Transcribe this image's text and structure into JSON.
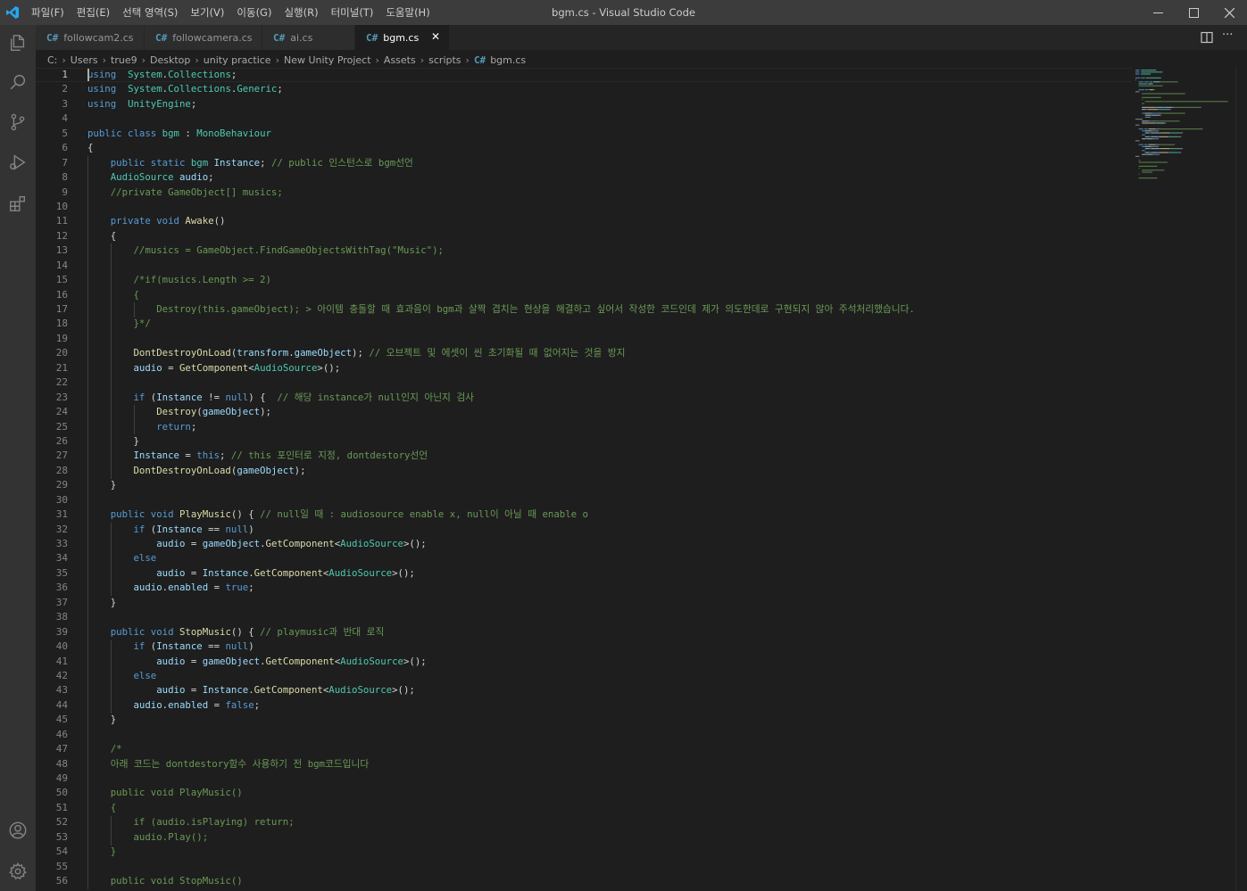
{
  "window": {
    "title": "bgm.cs - Visual Studio Code",
    "menu": [
      "파일(F)",
      "편집(E)",
      "선택 영역(S)",
      "보기(V)",
      "이동(G)",
      "실행(R)",
      "터미널(T)",
      "도움말(H)"
    ]
  },
  "tabs": [
    {
      "label": "followcam2.cs",
      "icon": "csharp-icon",
      "active": false
    },
    {
      "label": "followcamera.cs",
      "icon": "csharp-icon",
      "active": false
    },
    {
      "label": "ai.cs",
      "icon": "csharp-icon",
      "active": false
    },
    {
      "label": "bgm.cs",
      "icon": "csharp-icon",
      "active": true
    }
  ],
  "breadcrumb": [
    "C:",
    "Users",
    "true9",
    "Desktop",
    "unity practice",
    "New Unity Project",
    "Assets",
    "scripts",
    "bgm.cs"
  ],
  "editor": {
    "current_line": 1,
    "lines": [
      {
        "n": 1,
        "tokens": [
          [
            "k",
            "using"
          ],
          [
            "",
            "  "
          ],
          [
            "t",
            "System"
          ],
          [
            "",
            "."
          ],
          [
            "t",
            "Collections"
          ],
          [
            "",
            ";"
          ]
        ]
      },
      {
        "n": 2,
        "tokens": [
          [
            "k",
            "using"
          ],
          [
            "",
            "  "
          ],
          [
            "t",
            "System"
          ],
          [
            "",
            "."
          ],
          [
            "t",
            "Collections"
          ],
          [
            "",
            "."
          ],
          [
            "t",
            "Generic"
          ],
          [
            "",
            ";"
          ]
        ]
      },
      {
        "n": 3,
        "tokens": [
          [
            "k",
            "using"
          ],
          [
            "",
            "  "
          ],
          [
            "t",
            "UnityEngine"
          ],
          [
            "",
            ";"
          ]
        ]
      },
      {
        "n": 4,
        "tokens": []
      },
      {
        "n": 5,
        "tokens": [
          [
            "k",
            "public"
          ],
          [
            "",
            " "
          ],
          [
            "k",
            "class"
          ],
          [
            "",
            " "
          ],
          [
            "t",
            "bgm"
          ],
          [
            "",
            " : "
          ],
          [
            "t",
            "MonoBehaviour"
          ]
        ]
      },
      {
        "n": 6,
        "tokens": [
          [
            "",
            "{"
          ]
        ]
      },
      {
        "n": 7,
        "tokens": [
          [
            "",
            "    "
          ],
          [
            "k",
            "public"
          ],
          [
            "",
            " "
          ],
          [
            "k",
            "static"
          ],
          [
            "",
            " "
          ],
          [
            "t",
            "bgm"
          ],
          [
            "",
            " "
          ],
          [
            "v",
            "Instance"
          ],
          [
            "",
            "; "
          ],
          [
            "c",
            "// public 인스턴스로 bgm선언"
          ]
        ]
      },
      {
        "n": 8,
        "tokens": [
          [
            "",
            "    "
          ],
          [
            "t",
            "AudioSource"
          ],
          [
            "",
            " "
          ],
          [
            "v",
            "audio"
          ],
          [
            "",
            ";"
          ]
        ]
      },
      {
        "n": 9,
        "tokens": [
          [
            "",
            "    "
          ],
          [
            "c",
            "//private GameObject[] musics;"
          ]
        ]
      },
      {
        "n": 10,
        "tokens": []
      },
      {
        "n": 11,
        "tokens": [
          [
            "",
            "    "
          ],
          [
            "k",
            "private"
          ],
          [
            "",
            " "
          ],
          [
            "k",
            "void"
          ],
          [
            "",
            " "
          ],
          [
            "f",
            "Awake"
          ],
          [
            "",
            "()"
          ]
        ]
      },
      {
        "n": 12,
        "tokens": [
          [
            "",
            "    {"
          ]
        ]
      },
      {
        "n": 13,
        "tokens": [
          [
            "",
            "        "
          ],
          [
            "c",
            "//musics = GameObject.FindGameObjectsWithTag(\"Music\");"
          ]
        ]
      },
      {
        "n": 14,
        "tokens": []
      },
      {
        "n": 15,
        "tokens": [
          [
            "",
            "        "
          ],
          [
            "c",
            "/*if(musics.Length >= 2)"
          ]
        ]
      },
      {
        "n": 16,
        "tokens": [
          [
            "",
            "        "
          ],
          [
            "c",
            "{"
          ]
        ]
      },
      {
        "n": 17,
        "tokens": [
          [
            "",
            "            "
          ],
          [
            "c",
            "Destroy(this.gameObject); > 아이템 충돌할 때 효과음이 bgm과 살짝 겹치는 현상을 해결하고 싶어서 작성한 코드인데 제가 의도한데로 구현되지 않아 주석처리했습니다."
          ]
        ]
      },
      {
        "n": 18,
        "tokens": [
          [
            "",
            "        "
          ],
          [
            "c",
            "}*/"
          ]
        ]
      },
      {
        "n": 19,
        "tokens": []
      },
      {
        "n": 20,
        "tokens": [
          [
            "",
            "        "
          ],
          [
            "f",
            "DontDestroyOnLoad"
          ],
          [
            "",
            "("
          ],
          [
            "v",
            "transform"
          ],
          [
            "",
            "."
          ],
          [
            "v",
            "gameObject"
          ],
          [
            "",
            "); "
          ],
          [
            "c",
            "// 오브젝트 및 에셋이 씬 초기화될 때 없어지는 것을 방지"
          ]
        ]
      },
      {
        "n": 21,
        "tokens": [
          [
            "",
            "        "
          ],
          [
            "v",
            "audio"
          ],
          [
            "",
            " = "
          ],
          [
            "f",
            "GetComponent"
          ],
          [
            "",
            "<"
          ],
          [
            "t",
            "AudioSource"
          ],
          [
            "",
            ">();"
          ]
        ]
      },
      {
        "n": 22,
        "tokens": []
      },
      {
        "n": 23,
        "tokens": [
          [
            "",
            "        "
          ],
          [
            "k",
            "if"
          ],
          [
            "",
            " ("
          ],
          [
            "v",
            "Instance"
          ],
          [
            "",
            " != "
          ],
          [
            "k",
            "null"
          ],
          [
            "",
            ") {  "
          ],
          [
            "c",
            "// 해당 instance가 null인지 아닌지 검사"
          ]
        ]
      },
      {
        "n": 24,
        "tokens": [
          [
            "",
            "            "
          ],
          [
            "f",
            "Destroy"
          ],
          [
            "",
            "("
          ],
          [
            "v",
            "gameObject"
          ],
          [
            "",
            ");"
          ]
        ]
      },
      {
        "n": 25,
        "tokens": [
          [
            "",
            "            "
          ],
          [
            "k",
            "return"
          ],
          [
            "",
            ";"
          ]
        ]
      },
      {
        "n": 26,
        "tokens": [
          [
            "",
            "        }"
          ]
        ]
      },
      {
        "n": 27,
        "tokens": [
          [
            "",
            "        "
          ],
          [
            "v",
            "Instance"
          ],
          [
            "",
            " = "
          ],
          [
            "k",
            "this"
          ],
          [
            "",
            "; "
          ],
          [
            "c",
            "// this 포인터로 지정, dontdestory선언"
          ]
        ]
      },
      {
        "n": 28,
        "tokens": [
          [
            "",
            "        "
          ],
          [
            "f",
            "DontDestroyOnLoad"
          ],
          [
            "",
            "("
          ],
          [
            "v",
            "gameObject"
          ],
          [
            "",
            ");"
          ]
        ]
      },
      {
        "n": 29,
        "tokens": [
          [
            "",
            "    }"
          ]
        ]
      },
      {
        "n": 30,
        "tokens": []
      },
      {
        "n": 31,
        "tokens": [
          [
            "",
            "    "
          ],
          [
            "k",
            "public"
          ],
          [
            "",
            " "
          ],
          [
            "k",
            "void"
          ],
          [
            "",
            " "
          ],
          [
            "f",
            "PlayMusic"
          ],
          [
            "",
            "() { "
          ],
          [
            "c",
            "// null일 때 : audiosource enable x, null이 아닐 때 enable o"
          ]
        ]
      },
      {
        "n": 32,
        "tokens": [
          [
            "",
            "        "
          ],
          [
            "k",
            "if"
          ],
          [
            "",
            " ("
          ],
          [
            "v",
            "Instance"
          ],
          [
            "",
            " == "
          ],
          [
            "k",
            "null"
          ],
          [
            "",
            ")"
          ]
        ]
      },
      {
        "n": 33,
        "tokens": [
          [
            "",
            "            "
          ],
          [
            "v",
            "audio"
          ],
          [
            "",
            " = "
          ],
          [
            "v",
            "gameObject"
          ],
          [
            "",
            "."
          ],
          [
            "f",
            "GetComponent"
          ],
          [
            "",
            "<"
          ],
          [
            "t",
            "AudioSource"
          ],
          [
            "",
            ">();"
          ]
        ]
      },
      {
        "n": 34,
        "tokens": [
          [
            "",
            "        "
          ],
          [
            "k",
            "else"
          ]
        ]
      },
      {
        "n": 35,
        "tokens": [
          [
            "",
            "            "
          ],
          [
            "v",
            "audio"
          ],
          [
            "",
            " = "
          ],
          [
            "v",
            "Instance"
          ],
          [
            "",
            "."
          ],
          [
            "f",
            "GetComponent"
          ],
          [
            "",
            "<"
          ],
          [
            "t",
            "AudioSource"
          ],
          [
            "",
            ">();"
          ]
        ]
      },
      {
        "n": 36,
        "tokens": [
          [
            "",
            "        "
          ],
          [
            "v",
            "audio"
          ],
          [
            "",
            "."
          ],
          [
            "v",
            "enabled"
          ],
          [
            "",
            " = "
          ],
          [
            "k",
            "true"
          ],
          [
            "",
            ";"
          ]
        ]
      },
      {
        "n": 37,
        "tokens": [
          [
            "",
            "    }"
          ]
        ]
      },
      {
        "n": 38,
        "tokens": []
      },
      {
        "n": 39,
        "tokens": [
          [
            "",
            "    "
          ],
          [
            "k",
            "public"
          ],
          [
            "",
            " "
          ],
          [
            "k",
            "void"
          ],
          [
            "",
            " "
          ],
          [
            "f",
            "StopMusic"
          ],
          [
            "",
            "() { "
          ],
          [
            "c",
            "// playmusic과 반대 로직"
          ]
        ]
      },
      {
        "n": 40,
        "tokens": [
          [
            "",
            "        "
          ],
          [
            "k",
            "if"
          ],
          [
            "",
            " ("
          ],
          [
            "v",
            "Instance"
          ],
          [
            "",
            " == "
          ],
          [
            "k",
            "null"
          ],
          [
            "",
            ")"
          ]
        ]
      },
      {
        "n": 41,
        "tokens": [
          [
            "",
            "            "
          ],
          [
            "v",
            "audio"
          ],
          [
            "",
            " = "
          ],
          [
            "v",
            "gameObject"
          ],
          [
            "",
            "."
          ],
          [
            "f",
            "GetComponent"
          ],
          [
            "",
            "<"
          ],
          [
            "t",
            "AudioSource"
          ],
          [
            "",
            ">();"
          ]
        ]
      },
      {
        "n": 42,
        "tokens": [
          [
            "",
            "        "
          ],
          [
            "k",
            "else"
          ]
        ]
      },
      {
        "n": 43,
        "tokens": [
          [
            "",
            "            "
          ],
          [
            "v",
            "audio"
          ],
          [
            "",
            " = "
          ],
          [
            "v",
            "Instance"
          ],
          [
            "",
            "."
          ],
          [
            "f",
            "GetComponent"
          ],
          [
            "",
            "<"
          ],
          [
            "t",
            "AudioSource"
          ],
          [
            "",
            ">();"
          ]
        ]
      },
      {
        "n": 44,
        "tokens": [
          [
            "",
            "        "
          ],
          [
            "v",
            "audio"
          ],
          [
            "",
            "."
          ],
          [
            "v",
            "enabled"
          ],
          [
            "",
            " = "
          ],
          [
            "k",
            "false"
          ],
          [
            "",
            ";"
          ]
        ]
      },
      {
        "n": 45,
        "tokens": [
          [
            "",
            "    }"
          ]
        ]
      },
      {
        "n": 46,
        "tokens": []
      },
      {
        "n": 47,
        "tokens": [
          [
            "",
            "    "
          ],
          [
            "c",
            "/*"
          ]
        ]
      },
      {
        "n": 48,
        "tokens": [
          [
            "",
            "    "
          ],
          [
            "c",
            "아래 코드는 dontdestory함수 사용하기 전 bgm코드입니다"
          ]
        ]
      },
      {
        "n": 49,
        "tokens": []
      },
      {
        "n": 50,
        "tokens": [
          [
            "",
            "    "
          ],
          [
            "c",
            "public void PlayMusic()"
          ]
        ]
      },
      {
        "n": 51,
        "tokens": [
          [
            "",
            "    "
          ],
          [
            "c",
            "{"
          ]
        ]
      },
      {
        "n": 52,
        "tokens": [
          [
            "",
            "        "
          ],
          [
            "c",
            "if (audio.isPlaying) return;"
          ]
        ]
      },
      {
        "n": 53,
        "tokens": [
          [
            "",
            "        "
          ],
          [
            "c",
            "audio.Play();"
          ]
        ]
      },
      {
        "n": 54,
        "tokens": [
          [
            "",
            "    "
          ],
          [
            "c",
            "}"
          ]
        ]
      },
      {
        "n": 55,
        "tokens": []
      },
      {
        "n": 56,
        "tokens": [
          [
            "",
            "    "
          ],
          [
            "c",
            "public void StopMusic()"
          ]
        ]
      }
    ]
  },
  "colors": {
    "keyword": "#569cd6",
    "type": "#4ec9b0",
    "function": "#dcdcaa",
    "variable": "#9cdcfe",
    "comment": "#6a9955",
    "background": "#1e1e1e",
    "activity_bar": "#333333",
    "title_bar": "#3c3c3c"
  },
  "icons": {
    "activity": [
      "explorer-icon",
      "search-icon",
      "source-control-icon",
      "run-debug-icon",
      "extensions-icon",
      "account-icon",
      "settings-gear-icon"
    ],
    "window_controls": [
      "minimize-icon",
      "maximize-icon",
      "close-icon"
    ],
    "tab_actions": [
      "split-editor-icon",
      "more-actions-icon"
    ]
  }
}
